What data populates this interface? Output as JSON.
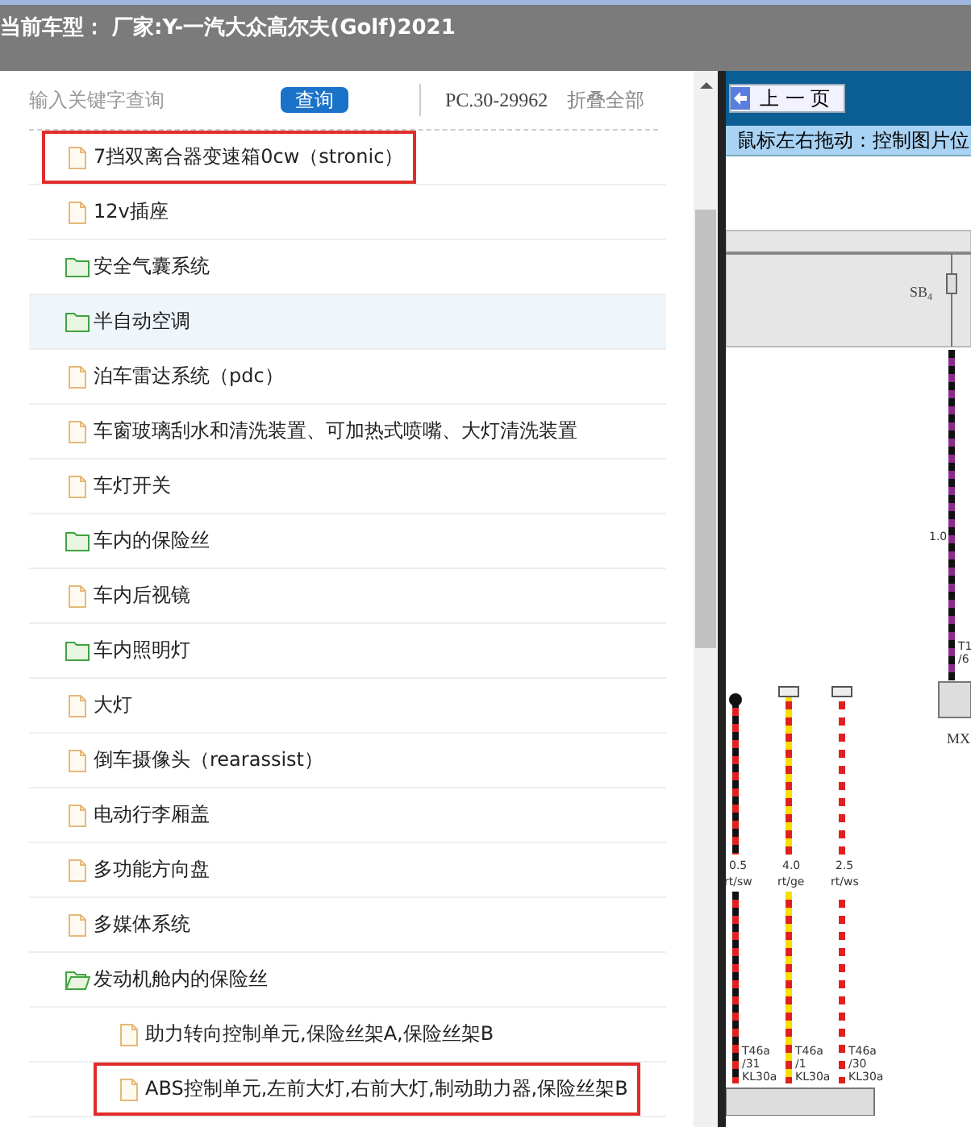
{
  "header": {
    "title": "当前车型： 厂家:Y-一汽大众高尔夫(Golf)2021"
  },
  "toolbar": {
    "search": {
      "placeholder": "输入关键字查询"
    },
    "search_button": "查询",
    "code": "PC.30-29962",
    "collapse_all": "折叠全部"
  },
  "tree": [
    {
      "kind": "file",
      "label": "7挡双离合器变速箱0cw（stronic）",
      "highlighted": true,
      "selected": false
    },
    {
      "kind": "file",
      "label": "12v插座",
      "highlighted": false,
      "selected": false
    },
    {
      "kind": "folder",
      "label": "安全气囊系统",
      "highlighted": false,
      "selected": false,
      "expanded": false
    },
    {
      "kind": "folder",
      "label": "半自动空调",
      "highlighted": false,
      "selected": true,
      "expanded": false
    },
    {
      "kind": "file",
      "label": "泊车雷达系统（pdc）",
      "highlighted": false,
      "selected": false
    },
    {
      "kind": "file",
      "label": "车窗玻璃刮水和清洗装置、可加热式喷嘴、大灯清洗装置",
      "highlighted": false,
      "selected": false
    },
    {
      "kind": "file",
      "label": "车灯开关",
      "highlighted": false,
      "selected": false
    },
    {
      "kind": "folder",
      "label": "车内的保险丝",
      "highlighted": false,
      "selected": false,
      "expanded": false
    },
    {
      "kind": "file",
      "label": "车内后视镜",
      "highlighted": false,
      "selected": false
    },
    {
      "kind": "folder",
      "label": "车内照明灯",
      "highlighted": false,
      "selected": false,
      "expanded": false
    },
    {
      "kind": "file",
      "label": "大灯",
      "highlighted": false,
      "selected": false
    },
    {
      "kind": "file",
      "label": "倒车摄像头（rearassist）",
      "highlighted": false,
      "selected": false
    },
    {
      "kind": "file",
      "label": "电动行李厢盖",
      "highlighted": false,
      "selected": false
    },
    {
      "kind": "file",
      "label": "多功能方向盘",
      "highlighted": false,
      "selected": false
    },
    {
      "kind": "file",
      "label": "多媒体系统",
      "highlighted": false,
      "selected": false
    },
    {
      "kind": "folder",
      "label": "发动机舱内的保险丝",
      "highlighted": false,
      "selected": false,
      "expanded": true,
      "children": [
        {
          "kind": "file",
          "label": "助力转向控制单元,保险丝架A,保险丝架B",
          "highlighted": false,
          "selected": false
        },
        {
          "kind": "file",
          "label": "ABS控制单元,左前大灯,右前大灯,制动助力器,保险丝架B",
          "highlighted": true,
          "selected": false
        }
      ]
    }
  ],
  "viewer": {
    "prev_button": "上 一 页",
    "hint": "鼠标左右拖动：控制图片位",
    "diagram": {
      "fuse_label": "SB$_{4}$",
      "component_label": "MX",
      "top_wire": {
        "gauge": "1.0",
        "pin": "T1",
        "pin_no": "/6"
      },
      "wires": [
        {
          "gauge": "0.5",
          "code": "rt/sw",
          "pin": "T46a",
          "pin_no": "/31",
          "terminal": "KL30a"
        },
        {
          "gauge": "4.0",
          "code": "rt/ge",
          "pin": "T46a",
          "pin_no": "/1",
          "terminal": "KL30a"
        },
        {
          "gauge": "2.5",
          "code": "rt/ws",
          "pin": "T46a",
          "pin_no": "/30",
          "terminal": "KL30a"
        }
      ]
    }
  }
}
